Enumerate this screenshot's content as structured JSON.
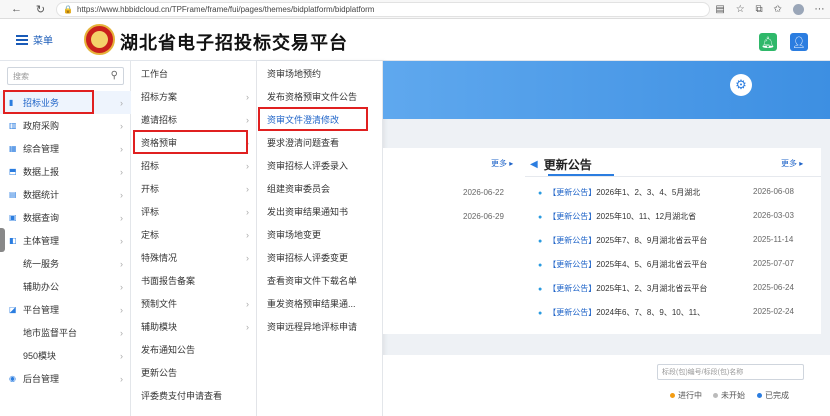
{
  "browser": {
    "url": "https://www.hbbidcloud.cn/TPFrame/frame/fui/pages/themes/bidplatform/bidplatform"
  },
  "header": {
    "menu_label": "菜单",
    "site_title": "湖北省电子招投标交易平台"
  },
  "mainmenu": {
    "search_placeholder": "搜索",
    "items": [
      {
        "label": "招标业务",
        "icon": "chart-icon",
        "chevron": true,
        "active": true
      },
      {
        "label": "政府采购",
        "icon": "building-icon",
        "chevron": true
      },
      {
        "label": "综合管理",
        "icon": "grid-icon",
        "chevron": true
      },
      {
        "label": "数据上报",
        "icon": "upload-icon",
        "chevron": true
      },
      {
        "label": "数据统计",
        "icon": "stats-icon",
        "chevron": true
      },
      {
        "label": "数据查询",
        "icon": "query-icon",
        "chevron": true
      },
      {
        "label": "主体管理",
        "icon": "entity-icon",
        "chevron": true
      },
      {
        "label": "统一服务",
        "icon": "",
        "chevron": true
      },
      {
        "label": "辅助办公",
        "icon": "",
        "chevron": true
      },
      {
        "label": "平台管理",
        "icon": "platform-icon",
        "chevron": true
      },
      {
        "label": "地市监督平台",
        "icon": "",
        "chevron": true
      },
      {
        "label": "950模块",
        "icon": "",
        "chevron": true
      },
      {
        "label": "后台管理",
        "icon": "admin-icon",
        "chevron": true
      }
    ]
  },
  "submenu": {
    "items": [
      {
        "label": "工作台",
        "chevron": false
      },
      {
        "label": "招标方案",
        "chevron": true
      },
      {
        "label": "邀请招标",
        "chevron": true
      },
      {
        "label": "资格预审",
        "chevron": true
      },
      {
        "label": "招标",
        "chevron": true
      },
      {
        "label": "开标",
        "chevron": true
      },
      {
        "label": "评标",
        "chevron": true
      },
      {
        "label": "定标",
        "chevron": true
      },
      {
        "label": "特殊情况",
        "chevron": true
      },
      {
        "label": "书面报告备案",
        "chevron": false
      },
      {
        "label": "预制文件",
        "chevron": true
      },
      {
        "label": "辅助模块",
        "chevron": true
      },
      {
        "label": "发布通知公告",
        "chevron": false
      },
      {
        "label": "更新公告",
        "chevron": false
      },
      {
        "label": "评委费支付申请查看",
        "chevron": false
      }
    ]
  },
  "thirdmenu": {
    "items": [
      "资审场地预约",
      "发布资格预审文件公告",
      "资审文件澄清修改",
      "要求澄清问题查看",
      "资审招标人评委录入",
      "组建资审委员会",
      "发出资审结果通知书",
      "资审场地变更",
      "资审招标人评委变更",
      "查看资审文件下载名单",
      "重发资格预审结果通...",
      "资审远程异地评标申请"
    ]
  },
  "content": {
    "more_left": "更多 ▸",
    "more_right": "更多 ▸",
    "updates_title": "更新公告",
    "left_dates": [
      "2026-06-22",
      "2026-06-29"
    ],
    "notices": [
      {
        "tag": "【更新公告】",
        "text": "2026年1、2、3、4、5月湖北",
        "date": "2026-06-08"
      },
      {
        "tag": "【更新公告】",
        "text": "2025年10、11、12月湖北省",
        "date": "2026-03-03"
      },
      {
        "tag": "【更新公告】",
        "text": "2025年7、8、9月湖北省云平台",
        "date": "2025-11-14"
      },
      {
        "tag": "【更新公告】",
        "text": "2025年4、5、6月湖北省云平台",
        "date": "2025-07-07"
      },
      {
        "tag": "【更新公告】",
        "text": "2025年1、2、3月湖北省云平台",
        "date": "2025-06-24"
      },
      {
        "tag": "【更新公告】",
        "text": "2024年6、7、8、9、10、11、",
        "date": "2025-02-24"
      }
    ],
    "filter_placeholder": "标段(包)编号/标段(包)名称",
    "legend": [
      {
        "label": "进行中",
        "color": "#f39c12"
      },
      {
        "label": "未开始",
        "color": "#bbbbbb"
      },
      {
        "label": "已完成",
        "color": "#2b7de0"
      }
    ]
  }
}
